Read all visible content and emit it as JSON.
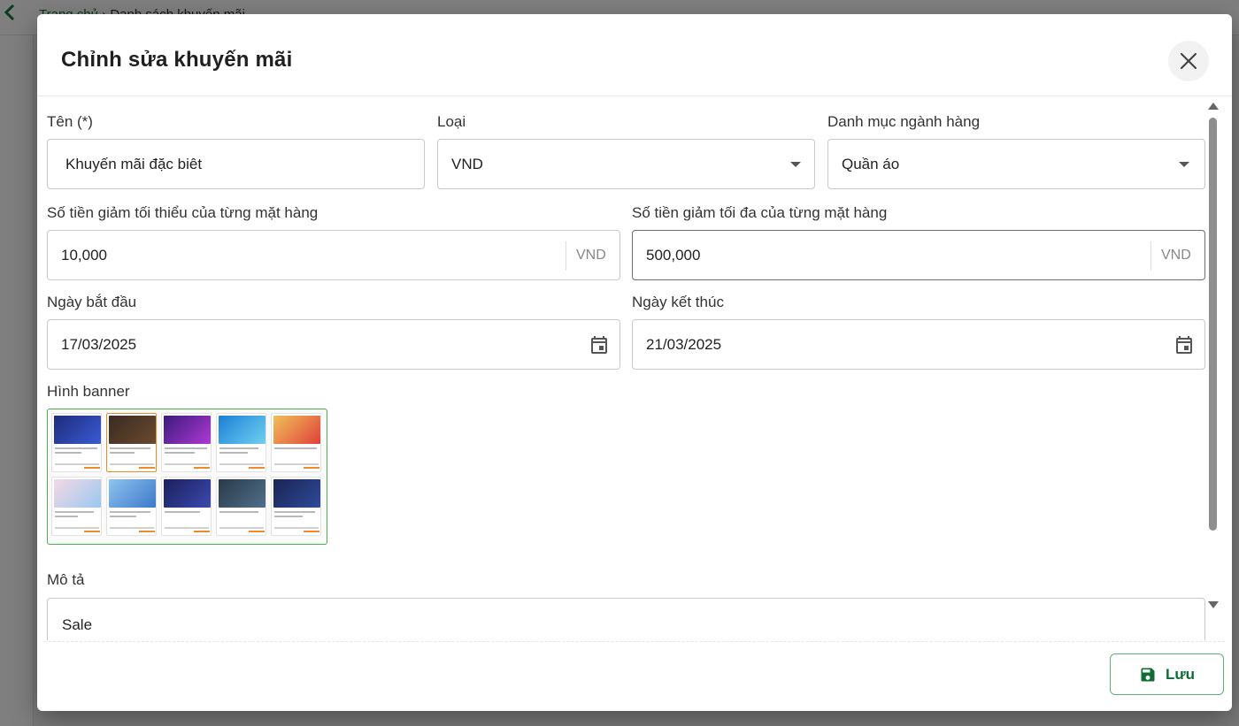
{
  "background": {
    "breadcrumb_home": "Trang chủ",
    "breadcrumb_sep": "›",
    "breadcrumb_current": "Danh sách khuyến mãi"
  },
  "modal": {
    "title": "Chỉnh sửa khuyến mãi",
    "fields": {
      "name": {
        "label": "Tên (*)",
        "value": "Khuyến mãi đặc biêt"
      },
      "type": {
        "label": "Loại",
        "value": "VND"
      },
      "category": {
        "label": "Danh mục ngành hàng",
        "value": "Quần áo"
      },
      "min_discount": {
        "label": "Số tiền giảm tối thiểu của từng mặt hàng",
        "value": "10,000",
        "unit": "VND"
      },
      "max_discount": {
        "label": "Số tiền giảm tối đa của từng mặt hàng",
        "value": "500,000",
        "unit": "VND"
      },
      "start_date": {
        "label": "Ngày bắt đầu",
        "value": "17/03/2025"
      },
      "end_date": {
        "label": "Ngày kết thúc",
        "value": "21/03/2025"
      },
      "banner": {
        "label": "Hình banner"
      },
      "description": {
        "label": "Mô tả",
        "value": "Sale"
      }
    },
    "save_label": "Lưu"
  },
  "colors": {
    "primary": "#0e6b33",
    "accent": "#4caf50",
    "title": "#1f1f1f"
  }
}
